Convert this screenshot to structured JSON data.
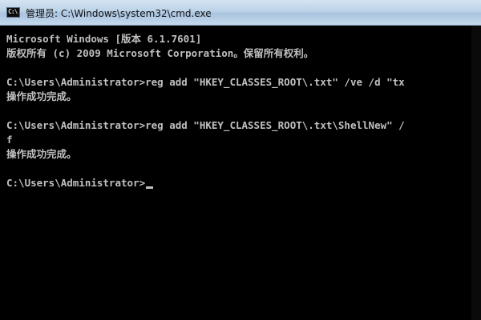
{
  "window": {
    "title": "管理员: C:\\Windows\\system32\\cmd.exe",
    "icon": "cmd-icon",
    "icon_glyph": "C:\\"
  },
  "console": {
    "lines": [
      "Microsoft Windows [版本 6.1.7601]",
      "版权所有 (c) 2009 Microsoft Corporation。保留所有权利。",
      "",
      "C:\\Users\\Administrator>reg add \"HKEY_CLASSES_ROOT\\.txt\" /ve /d \"tx",
      "操作成功完成。",
      "",
      "C:\\Users\\Administrator>reg add \"HKEY_CLASSES_ROOT\\.txt\\ShellNew\" /",
      "f",
      "操作成功完成。",
      "",
      "C:\\Users\\Administrator>"
    ]
  },
  "colors": {
    "background": "#000000",
    "text": "#c0c0c0"
  }
}
